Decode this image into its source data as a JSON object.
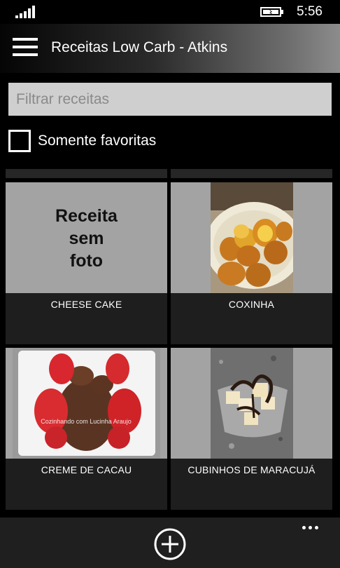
{
  "status_bar": {
    "time": "5:56",
    "signal_icon": "signal-bars-icon",
    "battery_icon": "battery-charging-icon"
  },
  "app_bar": {
    "menu_icon": "hamburger-menu-icon",
    "title": "Receitas Low Carb - Atkins"
  },
  "search": {
    "placeholder": "Filtrar receitas",
    "value": ""
  },
  "favorites_filter": {
    "label": "Somente favoritas",
    "checked": false
  },
  "recipes": [
    {
      "name": "CHEESE CAKE",
      "has_photo": false,
      "no_photo_text": [
        "Receita",
        "sem",
        "foto"
      ]
    },
    {
      "name": "COXINHA",
      "has_photo": true
    },
    {
      "name": "CREME DE CACAU",
      "has_photo": true,
      "photo_watermark": "Cozinhando com Lucinha Araujo"
    },
    {
      "name": "CUBINHOS DE MARACUJÁ",
      "has_photo": true
    }
  ],
  "bottom_bar": {
    "add_icon": "add-circle-icon",
    "more_icon": "ellipsis-icon"
  },
  "colors": {
    "background": "#000000",
    "tile_placeholder": "#a3a3a3",
    "tile_background": "#1e1e1e",
    "search_field": "#cfcfcf",
    "bottom_bar": "#1f1f1f"
  }
}
